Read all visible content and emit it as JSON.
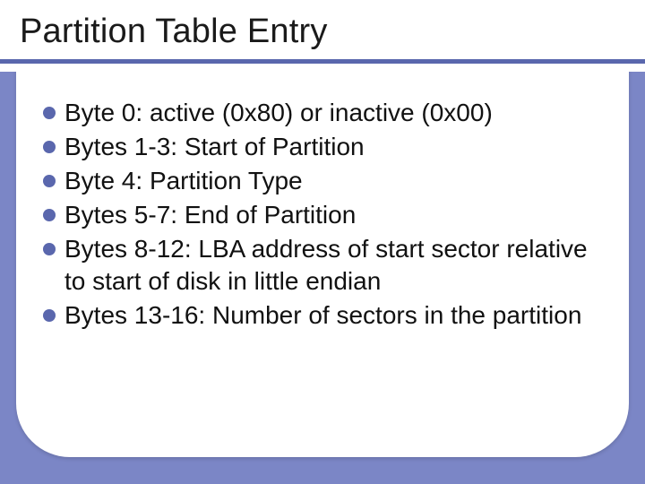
{
  "title": "Partition Table Entry",
  "bullets": [
    "Byte 0: active (0x80) or inactive (0x00)",
    "Bytes 1-3: Start of Partition",
    "Byte 4: Partition Type",
    "Bytes 5-7: End of Partition",
    "Bytes 8-12: LBA address of start sector relative to start of disk in little endian",
    "Bytes 13-16: Number of sectors in the partition"
  ]
}
